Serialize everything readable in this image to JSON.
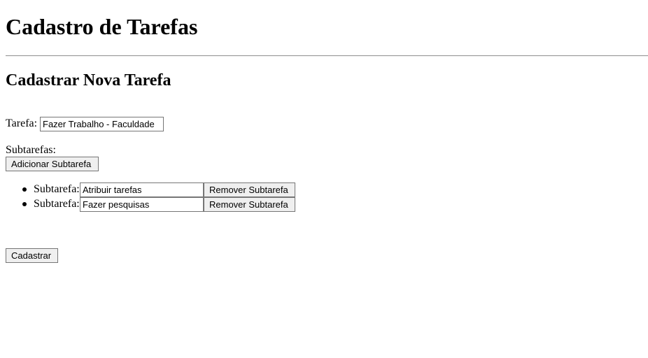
{
  "page": {
    "title": "Cadastro de Tarefas",
    "form_title": "Cadastrar Nova Tarefa"
  },
  "form": {
    "task_label": "Tarefa:",
    "task_value": "Fazer Trabalho - Faculdade",
    "subtasks_label": "Subtarefas:",
    "add_subtask_label": "Adicionar Subtarefa",
    "subtasks": [
      {
        "label": "Subtarefa:",
        "value": "Atribuir tarefas",
        "remove_label": "Remover Subtarefa"
      },
      {
        "label": "Subtarefa:",
        "value": "Fazer pesquisas",
        "remove_label": "Remover Subtarefa"
      }
    ],
    "submit_label": "Cadastrar"
  }
}
